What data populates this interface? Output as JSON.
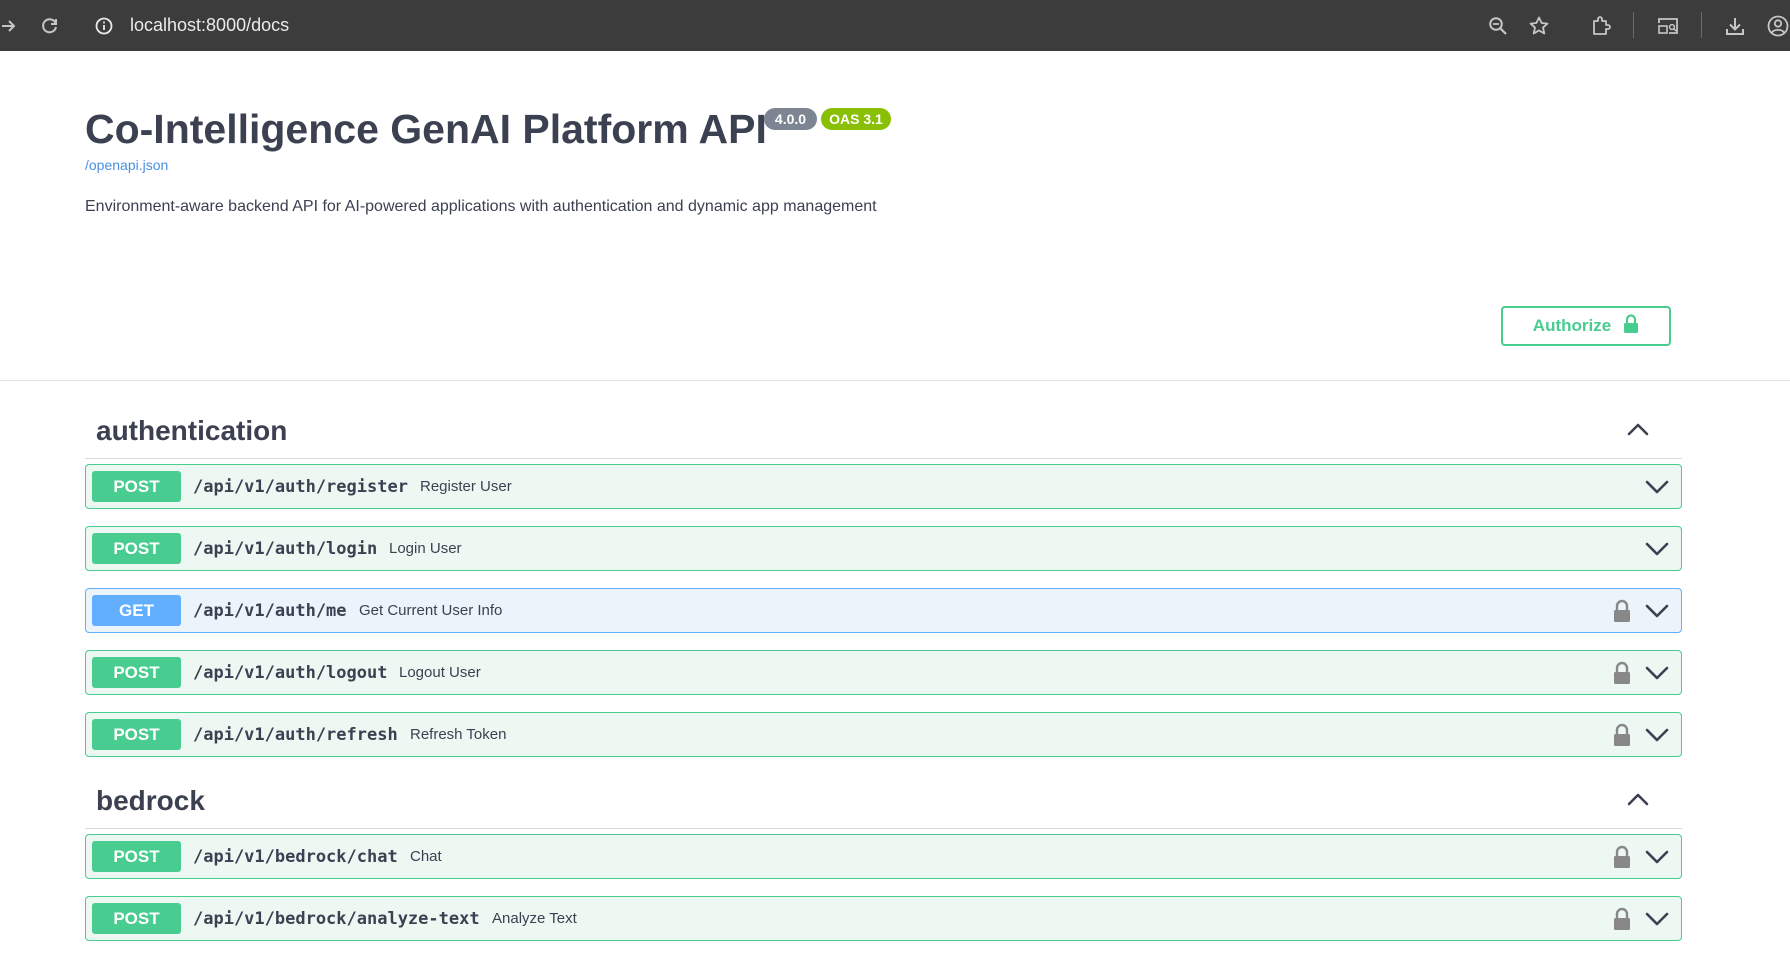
{
  "browser": {
    "url": "localhost:8000/docs",
    "icons": [
      "back-arrow-icon",
      "reload-icon",
      "info-icon",
      "zoom-icon",
      "star-icon",
      "extensions-icon",
      "cast-icon",
      "download-icon",
      "profile-icon"
    ]
  },
  "info": {
    "title": "Co-Intelligence GenAI Platform API",
    "version_badge": "4.0.0",
    "oas_badge": "OAS 3.1",
    "spec_link": "/openapi.json",
    "description": "Environment-aware backend API for AI-powered applications with authentication and dynamic app management"
  },
  "authorize": {
    "label": "Authorize"
  },
  "colors": {
    "post": "#49cc90",
    "get": "#61affe",
    "post_bg": "#edf8f3",
    "get_bg": "#ebf3fb",
    "text": "#3b4151"
  },
  "groups": [
    {
      "name": "authentication",
      "operations": [
        {
          "method": "POST",
          "path": "/api/v1/auth/register",
          "summary": "Register User",
          "locked": false
        },
        {
          "method": "POST",
          "path": "/api/v1/auth/login",
          "summary": "Login User",
          "locked": false
        },
        {
          "method": "GET",
          "path": "/api/v1/auth/me",
          "summary": "Get Current User Info",
          "locked": true
        },
        {
          "method": "POST",
          "path": "/api/v1/auth/logout",
          "summary": "Logout User",
          "locked": true
        },
        {
          "method": "POST",
          "path": "/api/v1/auth/refresh",
          "summary": "Refresh Token",
          "locked": true
        }
      ]
    },
    {
      "name": "bedrock",
      "operations": [
        {
          "method": "POST",
          "path": "/api/v1/bedrock/chat",
          "summary": "Chat",
          "locked": true
        },
        {
          "method": "POST",
          "path": "/api/v1/bedrock/analyze-text",
          "summary": "Analyze Text",
          "locked": true
        }
      ]
    }
  ]
}
